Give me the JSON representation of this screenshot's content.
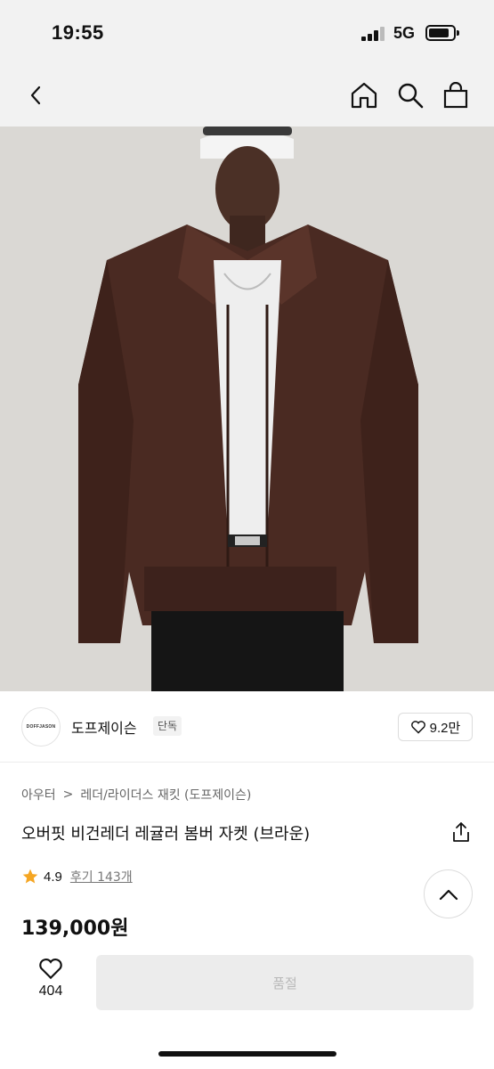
{
  "status_bar": {
    "time": "19:55",
    "network": "5G"
  },
  "nav": {
    "back_icon": "chevron-left-icon",
    "home_icon": "home-icon",
    "search_icon": "search-icon",
    "bag_icon": "shopping-bag-icon"
  },
  "hero": {
    "description_colors": {
      "jacket": "#4a2a22",
      "background": "#dad8d4"
    }
  },
  "brand": {
    "logo_text": "DOFFJASON",
    "name": "도프제이슨",
    "tag": "단독",
    "likes": "9.2만"
  },
  "breadcrumb": {
    "level1": "아우터",
    "separator": ">",
    "level2": "레더/라이더스 재킷 (도프제이슨)"
  },
  "product": {
    "title": "오버핏 비건레더 레귤러 봄버 자켓 (브라운)",
    "rating": "4.9",
    "reviews": "후기 143개",
    "price": "139,000원"
  },
  "bottom_bar": {
    "wish_count": "404",
    "buy_label": "품절"
  },
  "colors": {
    "accent_star": "#f5a623",
    "disabled_bg": "#ececec",
    "disabled_text": "#b8b8b8"
  }
}
